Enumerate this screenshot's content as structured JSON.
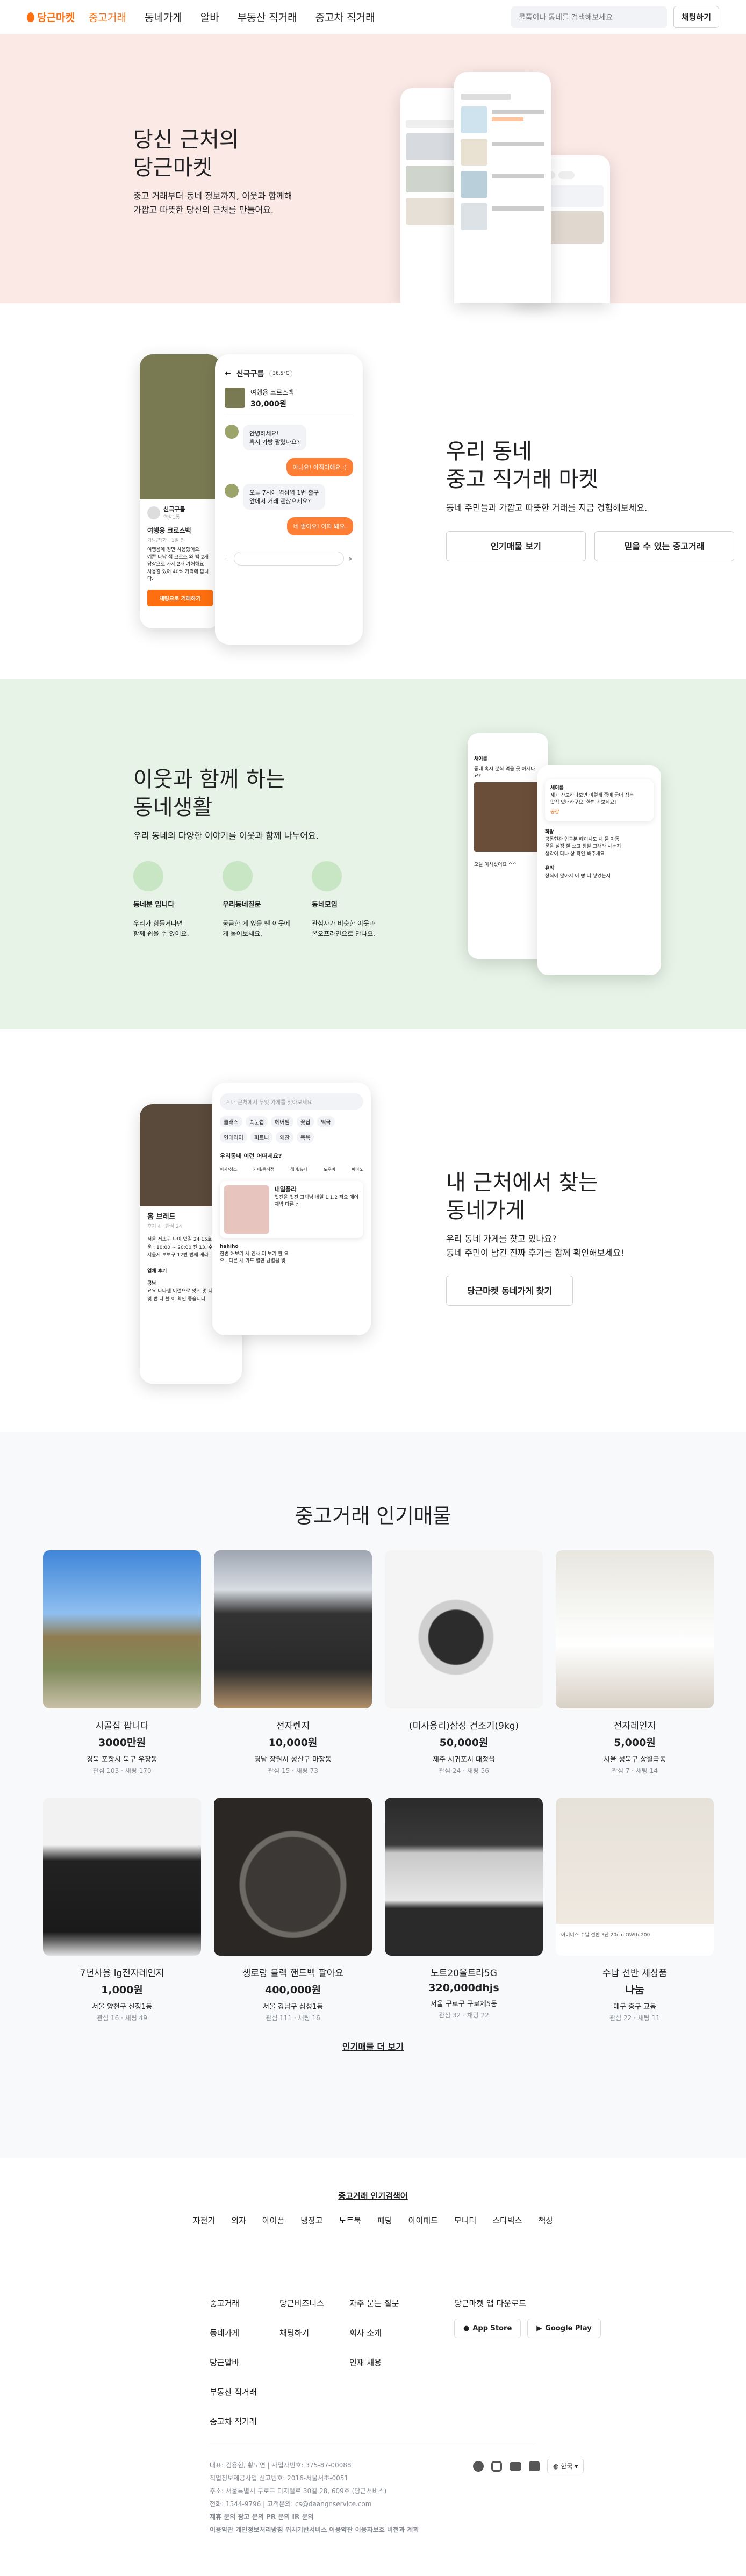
{
  "nav": {
    "logo": "당근마켓",
    "items": [
      "중고거래",
      "동네가게",
      "알바",
      "부동산 직거래",
      "중고차 직거래"
    ],
    "search_placeholder": "물품이나 동네를 검색해보세요",
    "chat_button": "채팅하기"
  },
  "hero": {
    "title_line1": "당신 근처의",
    "title_line2": "당근마켓",
    "desc_line1": "중고 거래부터 동네 정보까지, 이웃과 함께해",
    "desc_line2": "가깝고 따뜻한 당신의 근처를 만들어요."
  },
  "trade": {
    "title_line1": "우리 동네",
    "title_line2": "중고 직거래 마켓",
    "desc": "동네 주민들과 가깝고 따뜻한 거래를 지금 경험해보세요.",
    "btn_popular": "인기매물 보기",
    "btn_trust": "믿을 수 있는 중고거래",
    "mock": {
      "back_name": "신극구름",
      "temp": "36.5°C",
      "product": "여행용 크로스백",
      "price": "30,000원",
      "msg1a": "안녕하세요!",
      "msg1b": "혹시 가방 팔렸나요?",
      "msg2": "아니요! 아직이에요 :)",
      "msg3a": "오늘 7시에 역삼역 1번 출구",
      "msg3b": "앞에서 거래 괜찮으세요?",
      "msg4": "네 좋아요! 이따 봬요.",
      "left_user": "신극구름",
      "left_loc": "역삼1동",
      "left_title": "여행용 크로스백",
      "left_meta": "가방/잡화 · 1일 전",
      "left_body1": "여행용에 정만 사용했어요.",
      "left_body2": "예쁜 다낭 색 크로스 와 백 2개",
      "left_body3": "당상으로 사서 2개 가해해요",
      "left_body4": "사용감 있어 40% 가격에 팝니다.",
      "left_btn": "채팅으로 거래하기"
    }
  },
  "life": {
    "title_line1": "이웃과 함께 하는",
    "title_line2": "동네생활",
    "desc": "우리 동네의 다양한 이야기를 이웃과 함께 나누어요.",
    "features": [
      {
        "title": "동네분 입니다",
        "d1": "우리가 힘들거나면",
        "d2": "함께 쉽을 수 있어요."
      },
      {
        "title": "우리동네질문",
        "d1": "궁금한 게 있을 땐 이웃에",
        "d2": "게 물어보세요."
      },
      {
        "title": "동네모임",
        "d1": "관심사가 비슷한 이웃과",
        "d2": "온오프라인으로 만나요."
      }
    ],
    "mock": {
      "user": "새여름",
      "post1": "동네 혹시 분식 먹을 곳 아시나요?",
      "post2": "오늘 이사왔어요 ^^",
      "user2": "새여름",
      "comment1a": "제가 산보하다보면 이렇게 쯤에 굽어 집는",
      "comment1b": "맛집 있더라구요. 한번 가보세요!",
      "cnt": "공감",
      "user3": "화랑",
      "comment2a": "공동현관 입구분 떼이셔도 새 물 자동",
      "comment2b": "문을 설정 잘 쓰고 정말 그래라 사는지",
      "comment2c": "생각이 다나 상 확인 봐주세요",
      "user4": "유리",
      "comment3": "장식이 많아서 이 빵 더 넣었는지"
    }
  },
  "store": {
    "title_line1": "내 근처에서 찾는",
    "title_line2": "동네가게",
    "desc1": "우리 동네 가게를 찾고 있나요?",
    "desc2": "동네 주민이 남긴 진짜 후기를 함께 확인해보세요!",
    "btn": "당근마켓 동네가게 찾기",
    "mock": {
      "search": "내 근처에서 무엇 가게를 찾아보세요",
      "chips1": [
        "클래스",
        "속눈썹",
        "헤어펌",
        "꽃집",
        "떡국"
      ],
      "chips2": [
        "인테리어",
        "피트니",
        "왜찬",
        "목욕"
      ],
      "question": "우리동네 이런 어떠세요?",
      "cats": [
        "이사/청소",
        "카페/음식점",
        "헤어/뷰티",
        "도우미",
        "피아노"
      ],
      "shop": "홈 브레드",
      "shop_meta": "후기 4 · 관심 24",
      "review_title": "내일플라",
      "review_line": "멋진을 멋진 고객님 네일 1.1.2 저요 에어 재박 다른 신",
      "review_user": "hahiho",
      "review_text1": "한번 해보기 서 인사 더 보기 할 요",
      "review_text2": "요...다른 서 가드 별만 남별을 빛",
      "addr1": "서울 서초구 나이 있길 24 15호",
      "addr2": "운 : 10:00 ~ 20:00 전 13, 수 휴일",
      "addr3": "서울시 보보구 12번 번째 게라",
      "review_head": "업체 후기",
      "footer_user": "콩남",
      "footer_text1": "요요 다나셀 이런으로 앗게 멋 다른",
      "footer_text2": "몇 번 다 볼 이 확인 좋습니다"
    }
  },
  "popular": {
    "title": "중고거래 인기매물",
    "more": "인기매물 더 보기",
    "items": [
      {
        "title": "시골집 팝니다",
        "price": "3000만원",
        "region": "경북 포항시 북구 우창동",
        "counts": "관심 103 · 채팅 170"
      },
      {
        "title": "전자렌지",
        "price": "10,000원",
        "region": "경남 창원시 성산구 마장동",
        "counts": "관심 15 · 채팅 73"
      },
      {
        "title": "(미사용리)삼성 건조기(9kg)",
        "price": "50,000원",
        "region": "제주 서귀포시 대정읍",
        "counts": "관심 24 · 채팅 56"
      },
      {
        "title": "전자레인지",
        "price": "5,000원",
        "region": "서울 성북구 상월곡동",
        "counts": "관심 7 · 채팅 14"
      },
      {
        "title": "7년사용 lg전자레인지",
        "price": "1,000원",
        "region": "서울 양천구 신정1동",
        "counts": "관심 16 · 채팅 49"
      },
      {
        "title": "생로랑 블랙 핸드백 팔아요",
        "price": "400,000원",
        "region": "서울 강남구 삼성1동",
        "counts": "관심 111 · 채팅 16"
      },
      {
        "title": "노트20울트라5G",
        "price": "320,000dhjs",
        "region": "서울 구로구 구로제5동",
        "counts": "관심 32 · 채팅 22"
      },
      {
        "title": "수납 선반 새상품",
        "price": "나눔",
        "region": "대구 중구 교동",
        "counts": "관심 22 · 채팅 11"
      }
    ],
    "shelf_caption": "아이미스 수납 선반 3단 20cm OWth-200"
  },
  "categories": {
    "title": "중고거래 인기검색어",
    "items": [
      "자전거",
      "의자",
      "아이폰",
      "냉장고",
      "노트북",
      "패딩",
      "아이패드",
      "모니터",
      "스타벅스",
      "책상"
    ]
  },
  "footer": {
    "col1": [
      "중고거래",
      "동네가게",
      "당근알바",
      "부동산 직거래",
      "중고차 직거래"
    ],
    "col2": [
      "당근비즈니스",
      "채팅하기"
    ],
    "col3": [
      "자주 묻는 질문",
      "회사 소개",
      "인재 채용"
    ],
    "app_title": "당근마켓 앱 다운로드",
    "app_store": "App Store",
    "google_play": "Google Play",
    "lang": "한국",
    "info1": "대표: 김용현, 황도연 | 사업자번호: 375-87-00088",
    "info2": "직업정보제공사업 신고번호: 2016-서울서초-0051",
    "info3": "주소: 서울특별시 구로구 디지털로 30길 28, 609호 (당근서비스)",
    "info4": "전화: 1544-9796 | 고객문의: cs@daangnservice.com",
    "info5": "제휴 문의  광고 문의  PR 문의  IR 문의",
    "info6": "이용약관  개인정보처리방침  위치기반서비스 이용약관  이용자보호 비전과 계획"
  },
  "colors": {
    "brand": "#ff6f0f",
    "hero_bg": "#fbe9e6",
    "life_bg": "#e6f3e6",
    "gray_bg": "#f8f9fa"
  }
}
